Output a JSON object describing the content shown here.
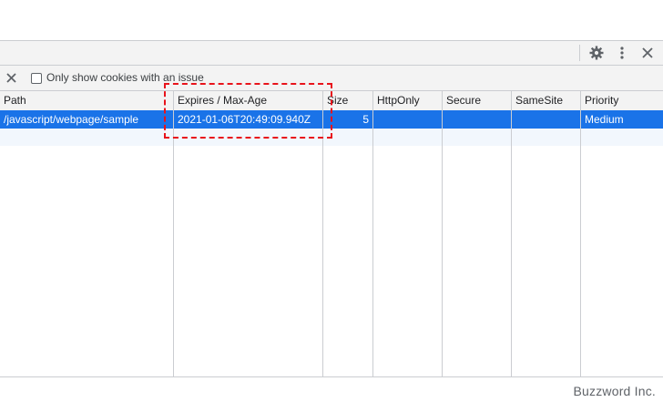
{
  "toolbar": {
    "settings_icon": "gear-icon",
    "more_icon": "vertical-ellipsis-icon",
    "close_icon": "close-icon"
  },
  "filter": {
    "clear_icon": "close-icon",
    "only_issues_label": "Only show cookies with an issue",
    "only_issues_checked": false
  },
  "table": {
    "columns": [
      "Path",
      "Expires / Max-Age",
      "Size",
      "HttpOnly",
      "Secure",
      "SameSite",
      "Priority"
    ],
    "rows": [
      {
        "path": "/javascript/webpage/sample",
        "expires": "2021-01-06T20:49:09.940Z",
        "size": "5",
        "httponly": "",
        "secure": "",
        "samesite": "",
        "priority": "Medium"
      }
    ]
  },
  "watermark": "Buzzword Inc.",
  "colors": {
    "selected_row": "#1a73e8",
    "highlight_box": "#e8131b"
  }
}
